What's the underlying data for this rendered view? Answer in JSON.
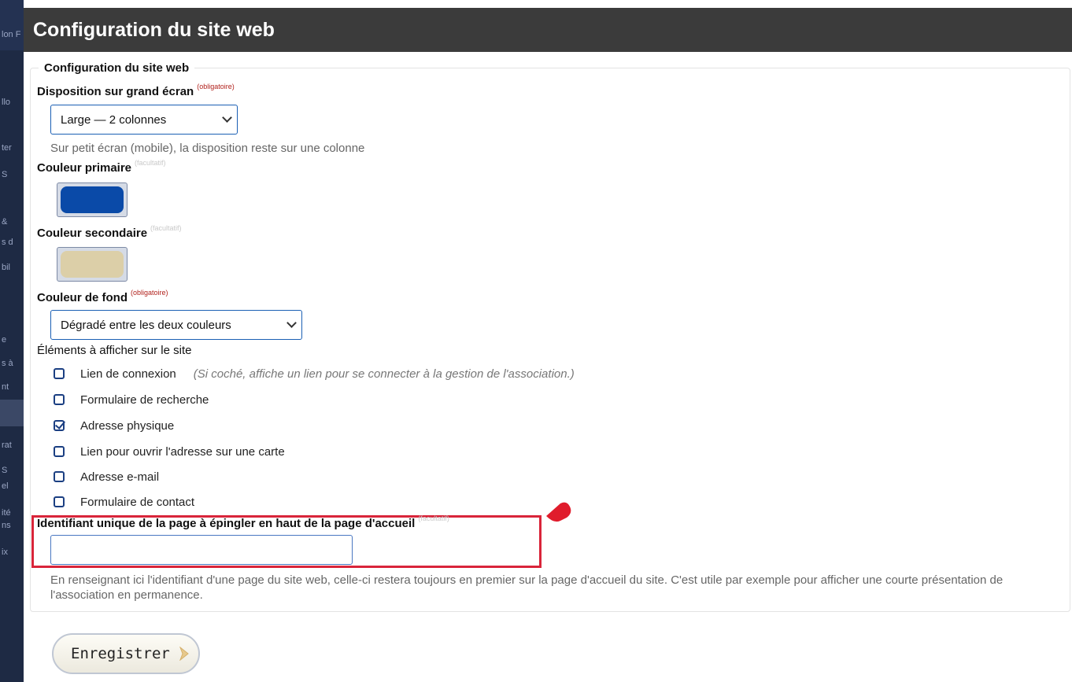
{
  "page": {
    "title": "Configuration du site web"
  },
  "sidebar": {
    "fragments": [
      "lon F",
      "llo",
      "ter",
      "S",
      "&",
      "s d",
      "bil",
      "e",
      "s à",
      "nt",
      "rat",
      "S",
      "el",
      "ité",
      "ns",
      "ix"
    ]
  },
  "form": {
    "legend": "Configuration du site web",
    "layout": {
      "label": "Disposition sur grand écran",
      "tag": "(obligatoire)",
      "selected": "Large — 2 colonnes",
      "help": "Sur petit écran (mobile), la disposition reste sur une colonne"
    },
    "primary_color": {
      "label": "Couleur primaire",
      "tag": "(facultatif)",
      "value": "#0a4aa8"
    },
    "secondary_color": {
      "label": "Couleur secondaire",
      "tag": "(facultatif)",
      "value": "#dccfa8"
    },
    "background": {
      "label": "Couleur de fond",
      "tag": "(obligatoire)",
      "selected": "Dégradé entre les deux couleurs"
    },
    "elements": {
      "label": "Éléments à afficher sur le site",
      "items": [
        {
          "label": "Lien de connexion",
          "hint": "(Si coché, affiche un lien pour se connecter à la gestion de l'association.)",
          "checked": false
        },
        {
          "label": "Formulaire de recherche",
          "checked": false
        },
        {
          "label": "Adresse physique",
          "checked": true
        },
        {
          "label": "Lien pour ouvrir l'adresse sur une carte",
          "checked": false
        },
        {
          "label": "Adresse e-mail",
          "checked": false
        },
        {
          "label": "Formulaire de contact",
          "checked": false
        }
      ]
    },
    "pinned_page": {
      "label": "Identifiant unique de la page à épingler en haut de la page d'accueil",
      "tag": "(facultatif)",
      "value": "",
      "help": "En renseignant ici l'identifiant d'une page du site web, celle-ci restera toujours en premier sur la page d'accueil du site. C'est utile par exemple pour afficher une courte présentation de l'association en permanence."
    }
  },
  "actions": {
    "save_label": "Enregistrer"
  },
  "colors": {
    "title_bar": "#3b3b3b",
    "highlight": "#d9253a",
    "link_blue": "#1a5fb4"
  }
}
